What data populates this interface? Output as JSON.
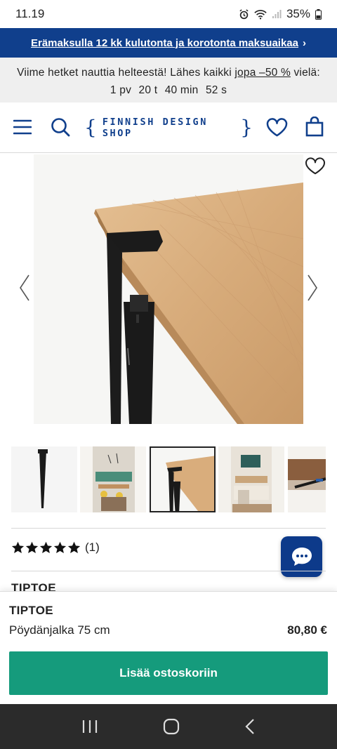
{
  "status": {
    "time": "11.19",
    "battery": "35%"
  },
  "promo": {
    "text": "Erämaksulla 12 kk kulutonta ja korotonta maksuaikaa",
    "chevron": "›"
  },
  "countdown": {
    "text_before": "Viime hetket nauttia helteestä! Lähes kaikki",
    "link": "jopa –50 %",
    "text_after": "vielä:",
    "days": "1 pv",
    "hours": "20 t",
    "minutes": "40 min",
    "seconds": "52 s"
  },
  "header": {
    "logo_text": "FINNISH DESIGN SHOP",
    "icons": [
      "menu-icon",
      "search-icon",
      "heart-icon",
      "bag-icon"
    ]
  },
  "gallery": {
    "thumb_count": 5,
    "active_index": 2
  },
  "rating": {
    "stars": 5,
    "count": "(1)"
  },
  "section_peek": "TIPTOE",
  "product": {
    "brand": "TIPTOE",
    "name": "Pöydänjalka 75 cm",
    "price": "80,80 €",
    "add_to_cart": "Lisää ostoskoriin"
  },
  "colors": {
    "brand_blue": "#103f8c",
    "cta_green": "#159b7c",
    "countdown_bg": "#efefef"
  }
}
